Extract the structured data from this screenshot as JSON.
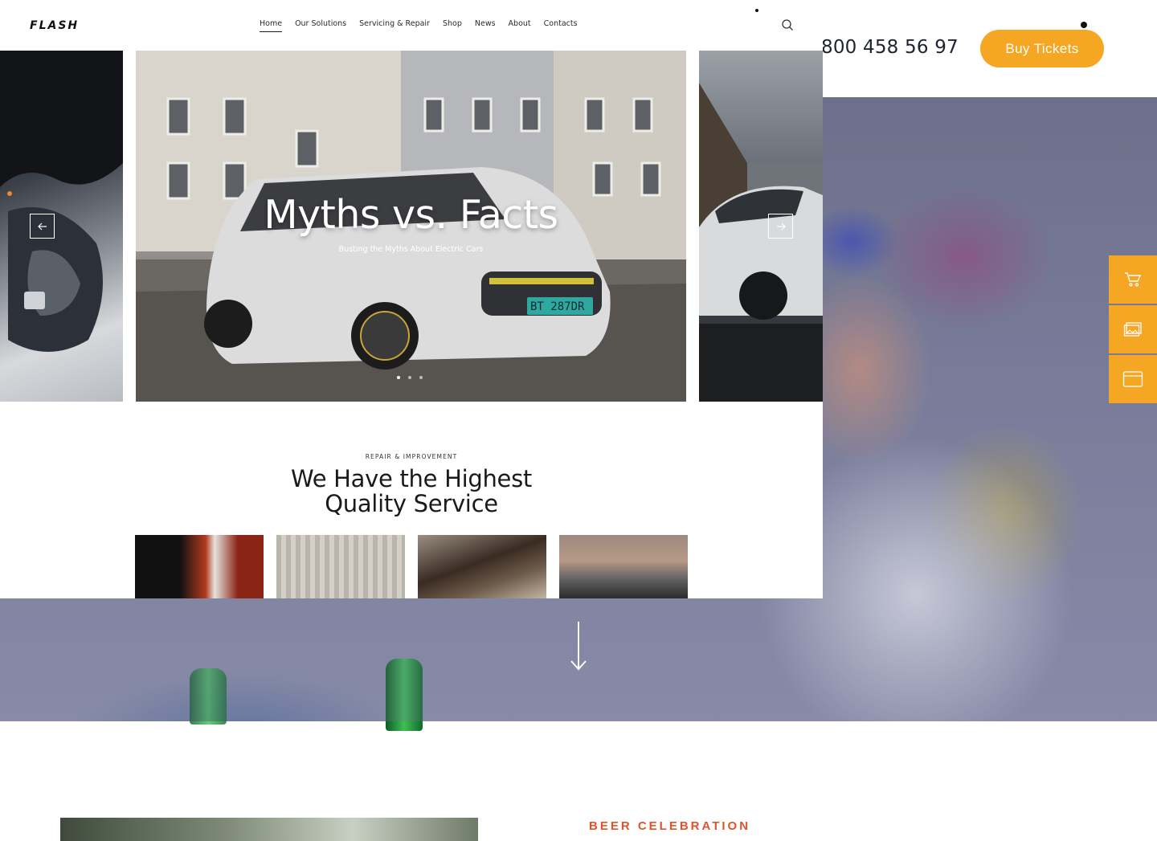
{
  "header": {
    "phone": "800 458 56 97",
    "buy_tickets_label": "Buy Tickets"
  },
  "side_tools": [
    "cart-icon",
    "gallery-icon",
    "browser-window-icon"
  ],
  "car_site": {
    "logo": "FLASH",
    "nav": [
      "Home",
      "Our Solutions",
      "Servicing & Repair",
      "Shop",
      "News",
      "About",
      "Contacts"
    ],
    "active_nav": "Home",
    "slider": {
      "title": "Myths vs. Facts",
      "subtitle": "Busting the Myths About Electric Cars",
      "plate": "BT 287DR",
      "slides_count": 3,
      "active_slide": 1
    },
    "section": {
      "kicker": "REPAIR & IMPROVEMENT",
      "title_line1": "We Have the Highest",
      "title_line2": "Quality Service"
    }
  },
  "lower": {
    "kicker": "BEER CELEBRATION"
  },
  "colors": {
    "accent": "#f5a623",
    "kicker": "#e0542c"
  }
}
